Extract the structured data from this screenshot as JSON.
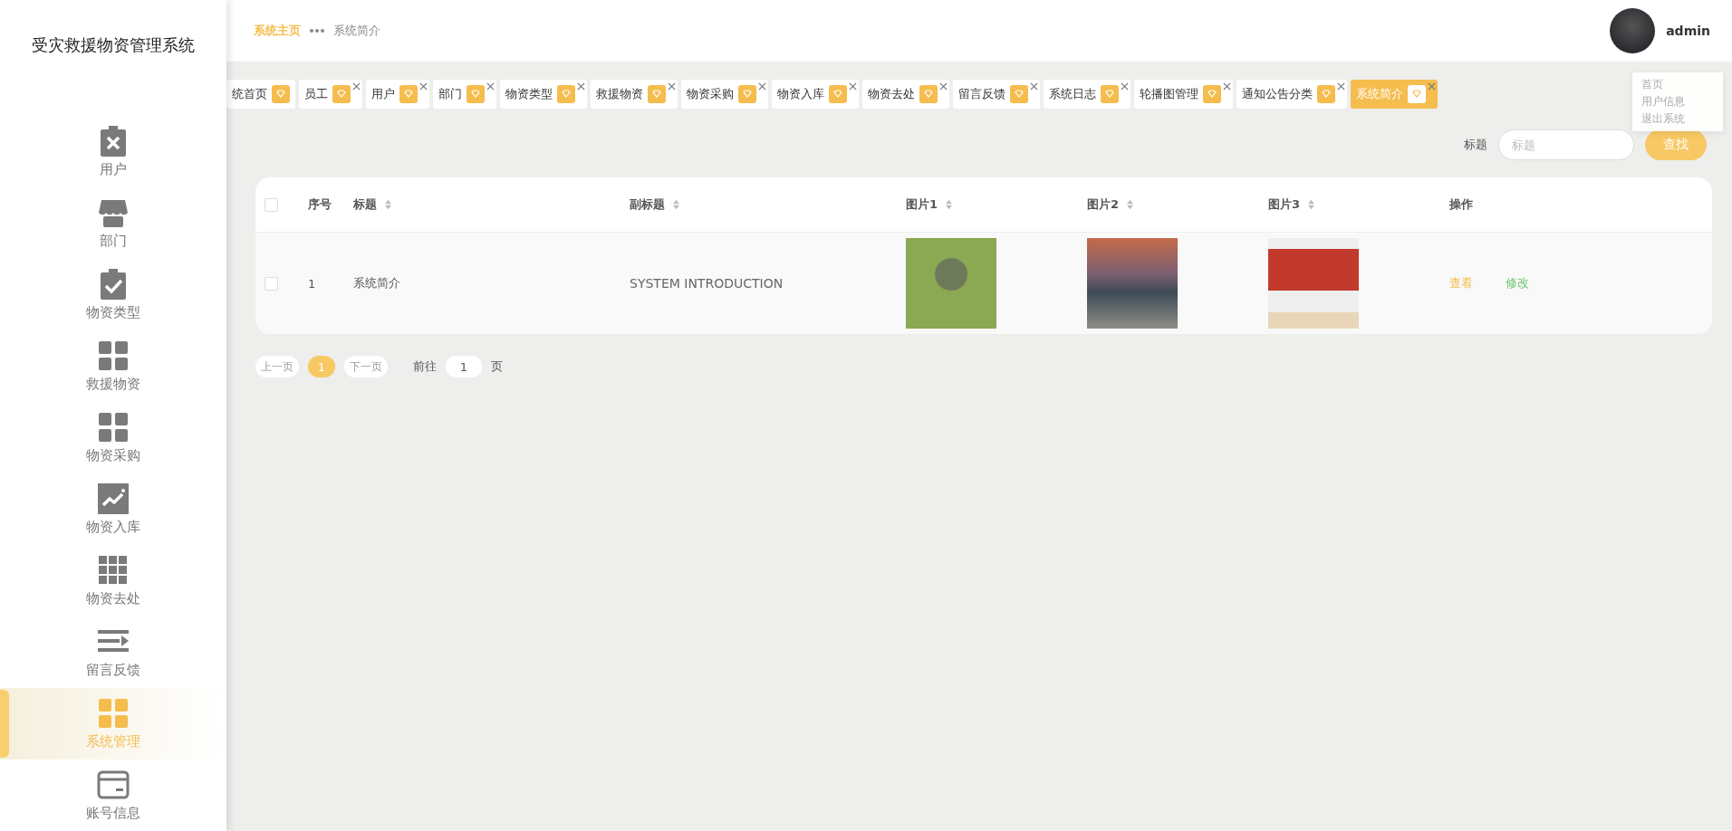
{
  "sidebar": {
    "title": "受灾救援物资管理系统",
    "items": [
      {
        "label": "用户",
        "selected": false
      },
      {
        "label": "部门",
        "selected": false
      },
      {
        "label": "物资类型",
        "selected": false
      },
      {
        "label": "救援物资",
        "selected": false
      },
      {
        "label": "物资采购",
        "selected": false
      },
      {
        "label": "物资入库",
        "selected": false
      },
      {
        "label": "物资去处",
        "selected": false
      },
      {
        "label": "留言反馈",
        "selected": false
      },
      {
        "label": "系统管理",
        "selected": true
      },
      {
        "label": "账号信息",
        "selected": false
      }
    ]
  },
  "breadcrumb": {
    "home": "系统主页",
    "current": "系统简介"
  },
  "user": {
    "name": "admin"
  },
  "user_menu": [
    "首页",
    "用户信息",
    "退出系统"
  ],
  "tabs": [
    {
      "label": "统首页",
      "selected": false,
      "closable": false
    },
    {
      "label": "员工",
      "selected": false,
      "closable": true
    },
    {
      "label": "用户",
      "selected": false,
      "closable": true
    },
    {
      "label": "部门",
      "selected": false,
      "closable": true
    },
    {
      "label": "物资类型",
      "selected": false,
      "closable": true
    },
    {
      "label": "救援物资",
      "selected": false,
      "closable": true
    },
    {
      "label": "物资采购",
      "selected": false,
      "closable": true
    },
    {
      "label": "物资入库",
      "selected": false,
      "closable": true
    },
    {
      "label": "物资去处",
      "selected": false,
      "closable": true
    },
    {
      "label": "留言反馈",
      "selected": false,
      "closable": true
    },
    {
      "label": "系统日志",
      "selected": false,
      "closable": true
    },
    {
      "label": "轮播图管理",
      "selected": false,
      "closable": true
    },
    {
      "label": "通知公告分类",
      "selected": false,
      "closable": true
    },
    {
      "label": "系统简介",
      "selected": true,
      "closable": true
    }
  ],
  "search": {
    "label": "标题",
    "placeholder": "标题",
    "button": "查找"
  },
  "table": {
    "all_checked": false,
    "columns": [
      {
        "label": "序号",
        "sortable": false
      },
      {
        "label": "标题",
        "sortable": true
      },
      {
        "label": "副标题",
        "sortable": true
      },
      {
        "label": "图片1",
        "sortable": true
      },
      {
        "label": "图片2",
        "sortable": true
      },
      {
        "label": "图片3",
        "sortable": true
      },
      {
        "label": "操作",
        "sortable": false
      }
    ],
    "rows": [
      {
        "checked": false,
        "index": "1",
        "title": "系统简介",
        "subtitle": "SYSTEM INTRODUCTION",
        "actions": [
          {
            "label": "查看",
            "kind": "view"
          },
          {
            "label": "修改",
            "kind": "edit"
          }
        ]
      }
    ]
  },
  "pagination": {
    "prev": "上一页",
    "pages": [
      {
        "label": "1",
        "selected": true
      }
    ],
    "next": "下一页",
    "goto_label": "前往",
    "goto_value": "1",
    "page_suffix": "页"
  }
}
